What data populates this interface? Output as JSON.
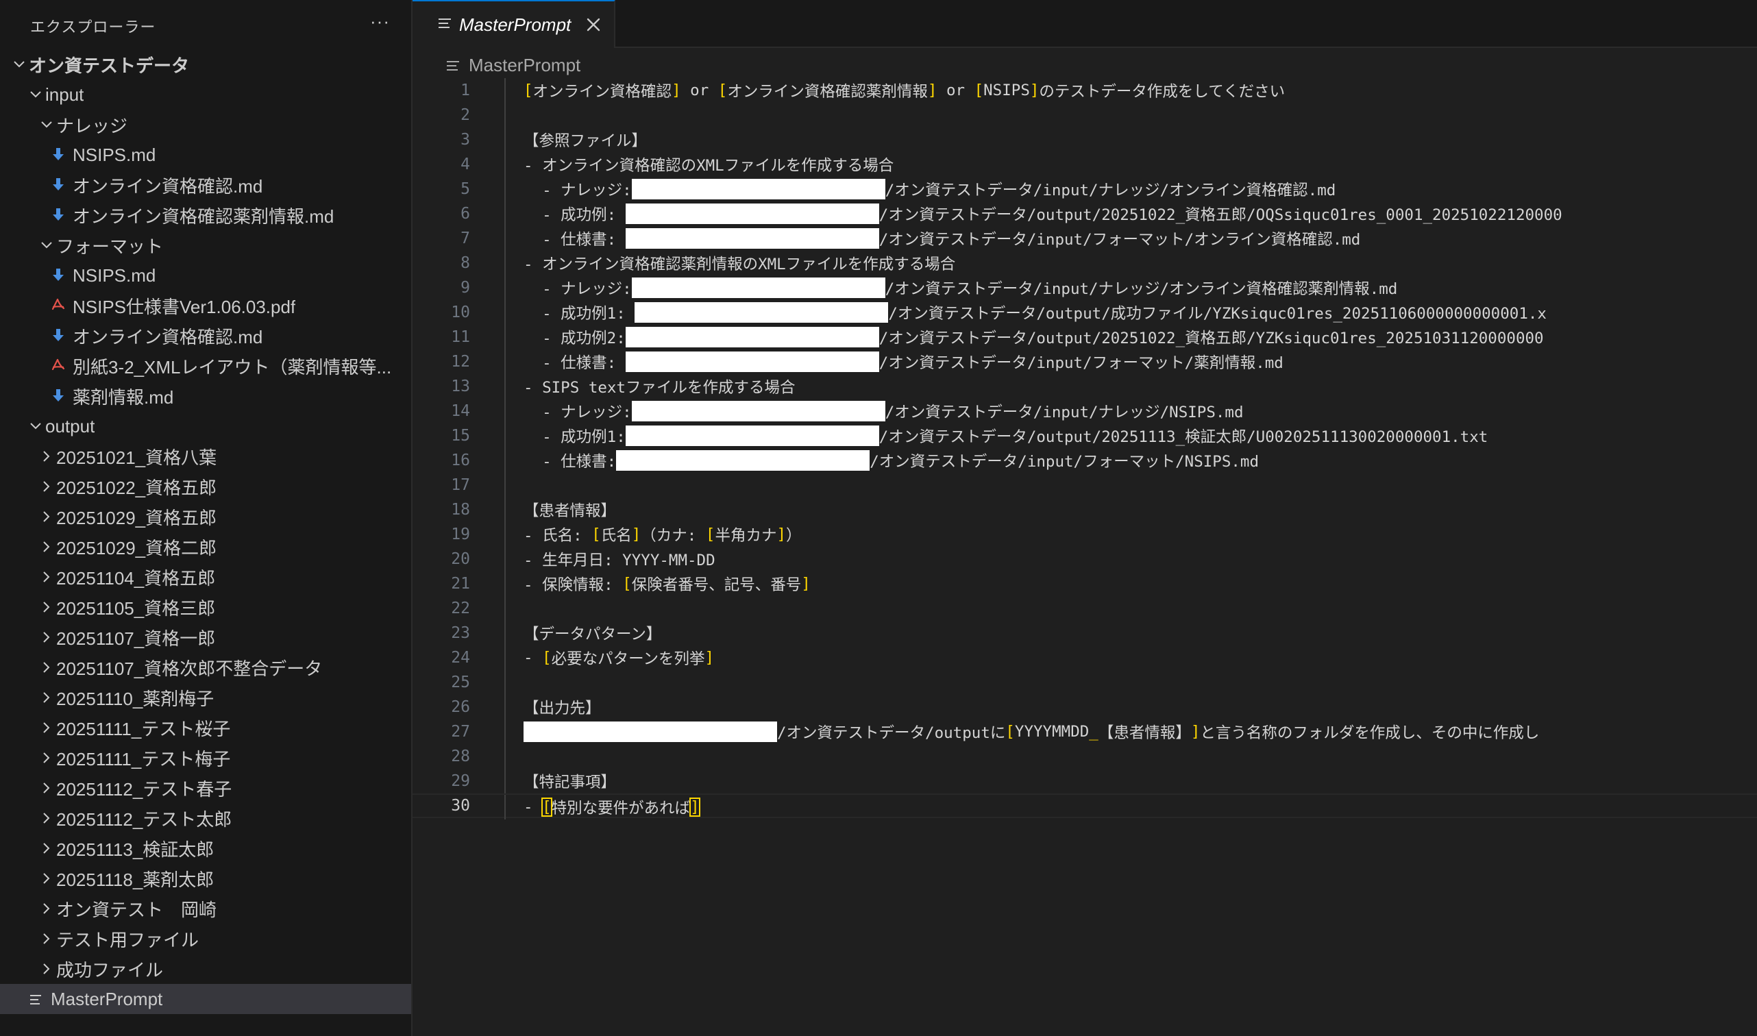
{
  "explorer": {
    "title": "エクスプローラー",
    "more_label": "···",
    "items": [
      {
        "label": "オン資テストデータ",
        "type": "folder",
        "expanded": true,
        "depth": 0,
        "bold": true
      },
      {
        "label": "input",
        "type": "folder",
        "expanded": true,
        "depth": 1
      },
      {
        "label": "ナレッジ",
        "type": "folder",
        "expanded": true,
        "depth": 2
      },
      {
        "label": "NSIPS.md",
        "type": "markdown",
        "depth": 3
      },
      {
        "label": "オンライン資格確認.md",
        "type": "markdown",
        "depth": 3
      },
      {
        "label": "オンライン資格確認薬剤情報.md",
        "type": "markdown",
        "depth": 3
      },
      {
        "label": "フォーマット",
        "type": "folder",
        "expanded": true,
        "depth": 2
      },
      {
        "label": "NSIPS.md",
        "type": "markdown",
        "depth": 3
      },
      {
        "label": "NSIPS仕様書Ver1.06.03.pdf",
        "type": "pdf",
        "depth": 3
      },
      {
        "label": "オンライン資格確認.md",
        "type": "markdown",
        "depth": 3
      },
      {
        "label": "別紙3-2_XMLレイアウト（薬剤情報等...",
        "type": "pdf",
        "depth": 3
      },
      {
        "label": "薬剤情報.md",
        "type": "markdown",
        "depth": 3
      },
      {
        "label": "output",
        "type": "folder",
        "expanded": true,
        "depth": 1
      },
      {
        "label": "20251021_資格八葉",
        "type": "folder",
        "expanded": false,
        "depth": 2
      },
      {
        "label": "20251022_資格五郎",
        "type": "folder",
        "expanded": false,
        "depth": 2
      },
      {
        "label": "20251029_資格五郎",
        "type": "folder",
        "expanded": false,
        "depth": 2
      },
      {
        "label": "20251029_資格二郎",
        "type": "folder",
        "expanded": false,
        "depth": 2
      },
      {
        "label": "20251104_資格五郎",
        "type": "folder",
        "expanded": false,
        "depth": 2
      },
      {
        "label": "20251105_資格三郎",
        "type": "folder",
        "expanded": false,
        "depth": 2
      },
      {
        "label": "20251107_資格一郎",
        "type": "folder",
        "expanded": false,
        "depth": 2
      },
      {
        "label": "20251107_資格次郎不整合データ",
        "type": "folder",
        "expanded": false,
        "depth": 2
      },
      {
        "label": "20251110_薬剤梅子",
        "type": "folder",
        "expanded": false,
        "depth": 2
      },
      {
        "label": "20251111_テスト桜子",
        "type": "folder",
        "expanded": false,
        "depth": 2
      },
      {
        "label": "20251111_テスト梅子",
        "type": "folder",
        "expanded": false,
        "depth": 2
      },
      {
        "label": "20251112_テスト春子",
        "type": "folder",
        "expanded": false,
        "depth": 2
      },
      {
        "label": "20251112_テスト太郎",
        "type": "folder",
        "expanded": false,
        "depth": 2
      },
      {
        "label": "20251113_検証太郎",
        "type": "folder",
        "expanded": false,
        "depth": 2
      },
      {
        "label": "20251118_薬剤太郎",
        "type": "folder",
        "expanded": false,
        "depth": 2
      },
      {
        "label": "オン資テスト　岡崎",
        "type": "folder",
        "expanded": false,
        "depth": 2
      },
      {
        "label": "テスト用ファイル",
        "type": "folder",
        "expanded": false,
        "depth": 2
      },
      {
        "label": "成功ファイル",
        "type": "folder",
        "expanded": false,
        "depth": 2
      },
      {
        "label": "MasterPrompt",
        "type": "text",
        "depth": 1,
        "selected": true
      }
    ]
  },
  "tab": {
    "label": "MasterPrompt",
    "icon": "text-file-icon",
    "close_icon": "close-icon"
  },
  "breadcrumb": {
    "label": "MasterPrompt"
  },
  "editor": {
    "current_line": 30,
    "lines": [
      [
        [
          "b",
          "["
        ],
        [
          "t",
          "オンライン資格確認"
        ],
        [
          "b",
          "]"
        ],
        [
          "t",
          " or "
        ],
        [
          "b",
          "["
        ],
        [
          "t",
          "オンライン資格確認薬剤情報"
        ],
        [
          "b",
          "]"
        ],
        [
          "t",
          " or "
        ],
        [
          "b",
          "["
        ],
        [
          "t",
          "NSIPS"
        ],
        [
          "b",
          "]"
        ],
        [
          "t",
          "のテストデータ作成をしてください"
        ]
      ],
      [],
      [
        [
          "t",
          "【参照ファイル】"
        ]
      ],
      [
        [
          "t",
          "- オンライン資格確認のXMLファイルを作成する場合"
        ]
      ],
      [
        [
          "t",
          "  - ナレッジ:"
        ],
        [
          "w",
          "370"
        ],
        [
          "t",
          "/オン資テストデータ/input/ナレッジ/オンライン資格確認.md"
        ]
      ],
      [
        [
          "t",
          "  - 成功例: "
        ],
        [
          "w",
          "370"
        ],
        [
          "t",
          "/オン資テストデータ/output/20251022_資格五郎/OQSsiquc01res_0001_20251022120000"
        ]
      ],
      [
        [
          "t",
          "  - 仕様書: "
        ],
        [
          "w",
          "370"
        ],
        [
          "t",
          "/オン資テストデータ/input/フォーマット/オンライン資格確認.md"
        ]
      ],
      [
        [
          "t",
          "- オンライン資格確認薬剤情報のXMLファイルを作成する場合"
        ]
      ],
      [
        [
          "t",
          "  - ナレッジ:"
        ],
        [
          "w",
          "370"
        ],
        [
          "t",
          "/オン資テストデータ/input/ナレッジ/オンライン資格確認薬剤情報.md"
        ]
      ],
      [
        [
          "t",
          "  - 成功例1: "
        ],
        [
          "w",
          "370"
        ],
        [
          "t",
          "/オン資テストデータ/output/成功ファイル/YZKsiquc01res_20251106000000000001.x"
        ]
      ],
      [
        [
          "t",
          "  - 成功例2:"
        ],
        [
          "w",
          "370"
        ],
        [
          "t",
          "/オン資テストデータ/output/20251022_資格五郎/YZKsiquc01res_20251031120000000"
        ]
      ],
      [
        [
          "t",
          "  - 仕様書: "
        ],
        [
          "w",
          "370"
        ],
        [
          "t",
          "/オン資テストデータ/input/フォーマット/薬剤情報.md"
        ]
      ],
      [
        [
          "t",
          "- SIPS textファイルを作成する場合"
        ]
      ],
      [
        [
          "t",
          "  - ナレッジ:"
        ],
        [
          "w",
          "370"
        ],
        [
          "t",
          "/オン資テストデータ/input/ナレッジ/NSIPS.md"
        ]
      ],
      [
        [
          "t",
          "  - 成功例1:"
        ],
        [
          "w",
          "370"
        ],
        [
          "t",
          "/オン資テストデータ/output/20251113_検証太郎/U00202511130020000001.txt"
        ]
      ],
      [
        [
          "t",
          "  - 仕様書:"
        ],
        [
          "w",
          "370"
        ],
        [
          "t",
          "/オン資テストデータ/input/フォーマット/NSIPS.md"
        ]
      ],
      [],
      [
        [
          "t",
          "【患者情報】"
        ]
      ],
      [
        [
          "t",
          "- 氏名: "
        ],
        [
          "b",
          "["
        ],
        [
          "t",
          "氏名"
        ],
        [
          "b",
          "]"
        ],
        [
          "t",
          "（カナ: "
        ],
        [
          "b",
          "["
        ],
        [
          "t",
          "半角カナ"
        ],
        [
          "b",
          "]"
        ],
        [
          "t",
          "）"
        ]
      ],
      [
        [
          "t",
          "- 生年月日: YYYY-MM-DD"
        ]
      ],
      [
        [
          "t",
          "- 保険情報: "
        ],
        [
          "b",
          "["
        ],
        [
          "t",
          "保険者番号、記号、番号"
        ],
        [
          "b",
          "]"
        ]
      ],
      [],
      [
        [
          "t",
          "【データパターン】"
        ]
      ],
      [
        [
          "t",
          "- "
        ],
        [
          "b",
          "["
        ],
        [
          "t",
          "必要なパターンを列挙"
        ],
        [
          "b",
          "]"
        ]
      ],
      [],
      [
        [
          "t",
          "【出力先】"
        ]
      ],
      [
        [
          "w",
          "370"
        ],
        [
          "t",
          "/オン資テストデータ/outputに"
        ],
        [
          "b",
          "["
        ],
        [
          "t",
          "YYYYMMDD"
        ],
        [
          "b",
          "_"
        ],
        [
          "t",
          "【患者情報】"
        ],
        [
          "b",
          "]"
        ],
        [
          "t",
          "と言う名称のフォルダを作成し、その中に作成し"
        ]
      ],
      [],
      [
        [
          "t",
          "【特記事項】"
        ]
      ],
      [
        [
          "t",
          "- "
        ],
        [
          "B",
          "["
        ],
        [
          "t",
          "特別な要件があれば"
        ],
        [
          "B",
          "]"
        ]
      ]
    ]
  },
  "colors": {
    "bracket": "#ffd700",
    "accent": "#0078d4",
    "selected_row": "#37373d",
    "markdown_icon": "#4a90e2",
    "pdf_icon": "#e5534b"
  }
}
